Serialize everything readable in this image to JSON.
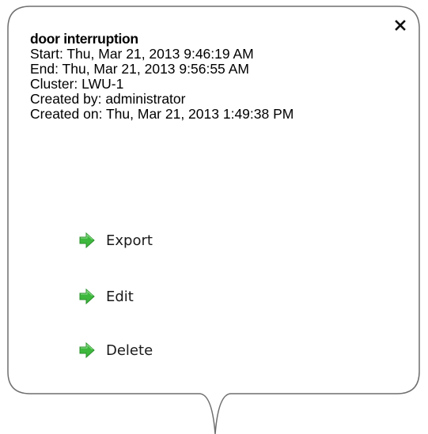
{
  "popup": {
    "title": "door interruption",
    "start": "Start: Thu, Mar 21, 2013 9:46:19 AM",
    "end": "End: Thu, Mar 21, 2013 9:56:55 AM",
    "cluster": "Cluster: LWU-1",
    "created_by": "Created by: administrator",
    "created_on": "Created on: Thu, Mar 21, 2013 1:49:38 PM",
    "close_glyph": "✕"
  },
  "actions": {
    "export_label": "Export",
    "edit_label": "Edit",
    "delete_label": "Delete",
    "icon": "green-right-arrow-icon",
    "icon_color": "#3db83d"
  }
}
